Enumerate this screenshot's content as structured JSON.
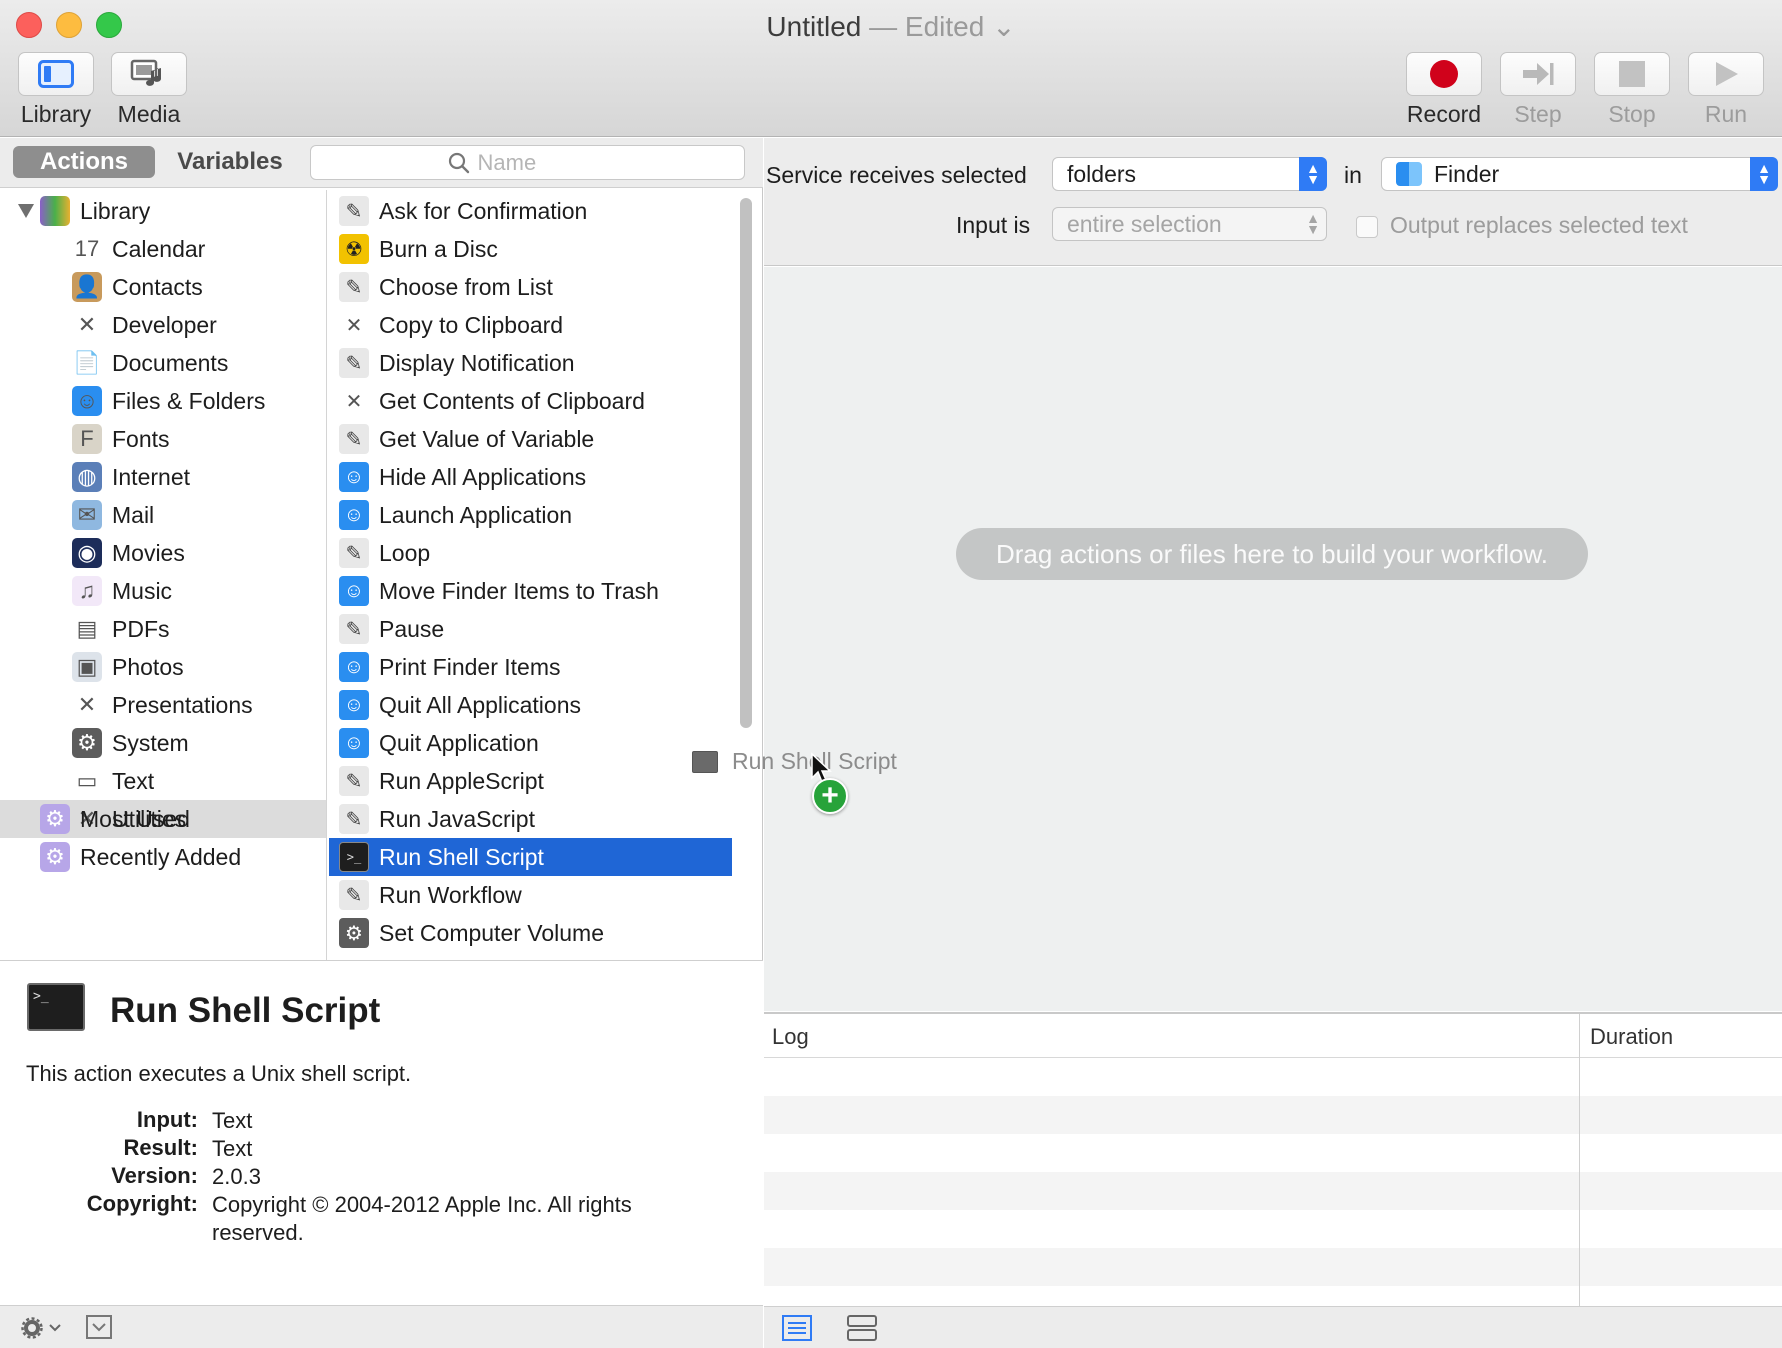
{
  "window": {
    "title": "Untitled",
    "title_suffix": "— Edited",
    "title_chevron": "⌄"
  },
  "toolbar": {
    "library_label": "Library",
    "media_label": "Media",
    "record_label": "Record",
    "step_label": "Step",
    "stop_label": "Stop",
    "run_label": "Run"
  },
  "tabs": {
    "actions": "Actions",
    "variables": "Variables"
  },
  "search": {
    "placeholder": "Name"
  },
  "library": {
    "root": "Library",
    "items": [
      {
        "label": "Calendar",
        "icon": "calendar-icon",
        "glyph": "17"
      },
      {
        "label": "Contacts",
        "icon": "contacts-icon",
        "glyph": "👤"
      },
      {
        "label": "Developer",
        "icon": "developer-icon",
        "glyph": "✕"
      },
      {
        "label": "Documents",
        "icon": "documents-icon",
        "glyph": "📄"
      },
      {
        "label": "Files & Folders",
        "icon": "finder-icon",
        "glyph": "☺"
      },
      {
        "label": "Fonts",
        "icon": "fonts-icon",
        "glyph": "F"
      },
      {
        "label": "Internet",
        "icon": "internet-icon",
        "glyph": "◍"
      },
      {
        "label": "Mail",
        "icon": "mail-icon",
        "glyph": "✉"
      },
      {
        "label": "Movies",
        "icon": "movies-icon",
        "glyph": "◉"
      },
      {
        "label": "Music",
        "icon": "music-icon",
        "glyph": "♫"
      },
      {
        "label": "PDFs",
        "icon": "pdf-icon",
        "glyph": "▤"
      },
      {
        "label": "Photos",
        "icon": "photos-icon",
        "glyph": "▣"
      },
      {
        "label": "Presentations",
        "icon": "presentations-icon",
        "glyph": "✕"
      },
      {
        "label": "System",
        "icon": "system-icon",
        "glyph": "⚙"
      },
      {
        "label": "Text",
        "icon": "text-icon",
        "glyph": "▭"
      },
      {
        "label": "Utilities",
        "icon": "utilities-icon",
        "glyph": "✕"
      }
    ],
    "most_used": "Most Used",
    "recently_added": "Recently Added",
    "selected": "Utilities"
  },
  "actions": {
    "items": [
      {
        "label": "Ask for Confirmation",
        "icon": "automator-icon"
      },
      {
        "label": "Burn a Disc",
        "icon": "burn-icon"
      },
      {
        "label": "Choose from List",
        "icon": "automator-icon"
      },
      {
        "label": "Copy to Clipboard",
        "icon": "tools-icon"
      },
      {
        "label": "Display Notification",
        "icon": "automator-icon"
      },
      {
        "label": "Get Contents of Clipboard",
        "icon": "tools-icon"
      },
      {
        "label": "Get Value of Variable",
        "icon": "automator-icon"
      },
      {
        "label": "Hide All Applications",
        "icon": "finder-icon"
      },
      {
        "label": "Launch Application",
        "icon": "finder-icon"
      },
      {
        "label": "Loop",
        "icon": "automator-icon"
      },
      {
        "label": "Move Finder Items to Trash",
        "icon": "finder-icon"
      },
      {
        "label": "Pause",
        "icon": "automator-icon"
      },
      {
        "label": "Print Finder Items",
        "icon": "finder-icon"
      },
      {
        "label": "Quit All Applications",
        "icon": "finder-icon"
      },
      {
        "label": "Quit Application",
        "icon": "finder-icon"
      },
      {
        "label": "Run AppleScript",
        "icon": "automator-icon"
      },
      {
        "label": "Run JavaScript",
        "icon": "automator-icon"
      },
      {
        "label": "Run Shell Script",
        "icon": "terminal-icon"
      },
      {
        "label": "Run Workflow",
        "icon": "automator-icon"
      },
      {
        "label": "Set Computer Volume",
        "icon": "system-icon"
      }
    ],
    "selected": "Run Shell Script"
  },
  "description": {
    "title": "Run Shell Script",
    "summary": "This action executes a Unix shell script.",
    "input_key": "Input:",
    "input_val": "Text",
    "result_key": "Result:",
    "result_val": "Text",
    "version_key": "Version:",
    "version_val": "2.0.3",
    "copyright_key": "Copyright:",
    "copyright_val": "Copyright © 2004-2012 Apple Inc.  All rights reserved."
  },
  "service": {
    "receives_label": "Service receives selected",
    "receives_value": "folders",
    "in_label": "in",
    "app_value": "Finder",
    "input_is_label": "Input is",
    "input_is_value": "entire selection",
    "output_replaces_label": "Output replaces selected text"
  },
  "workflow": {
    "drop_hint": "Drag actions or files here to build your workflow.",
    "drag_ghost_label": "Run Shell Script",
    "drag_add_glyph": "+"
  },
  "log": {
    "col_log": "Log",
    "col_duration": "Duration"
  },
  "colors": {
    "selection_blue": "#1f66d6",
    "record_red": "#d0021b",
    "add_green": "#27a33a"
  }
}
